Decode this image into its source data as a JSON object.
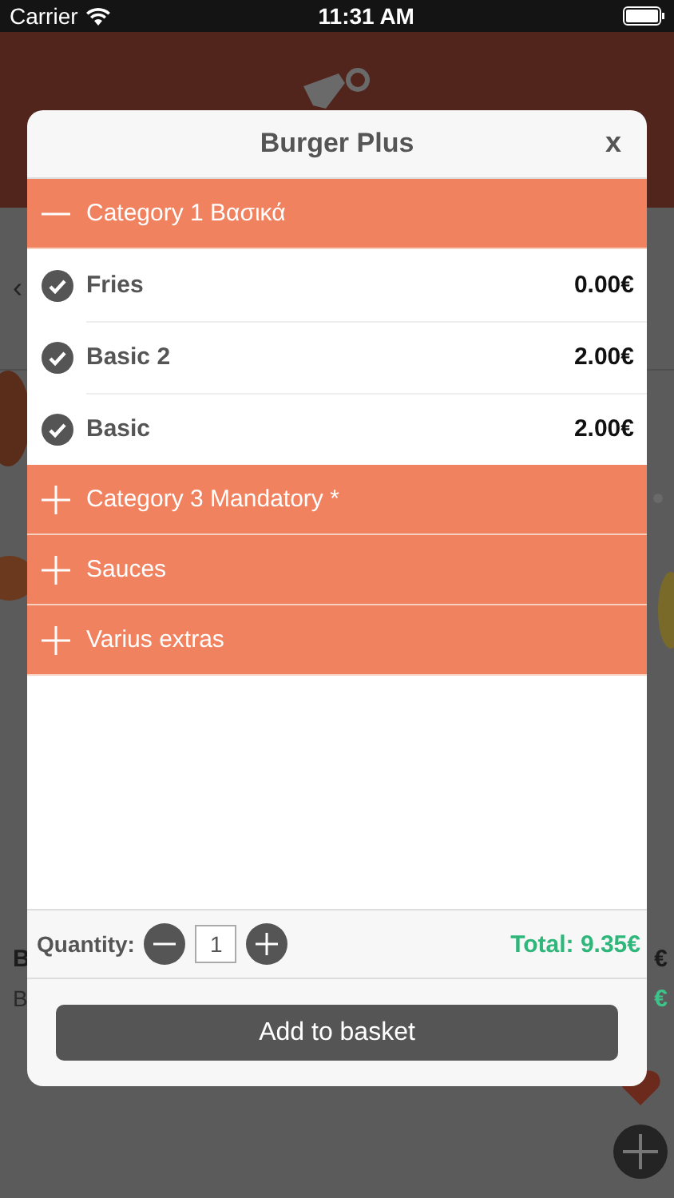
{
  "status_bar": {
    "carrier": "Carrier",
    "time": "11:31 AM"
  },
  "background": {
    "back": "‹",
    "item_name": "B",
    "item_desc": "B",
    "item_price": "€",
    "item_price_2": "€"
  },
  "modal": {
    "title": "Burger Plus",
    "close": "x",
    "categories": [
      {
        "name": "Category 1 Βασικά",
        "expanded": true,
        "options": [
          {
            "name": "Fries",
            "price": "0.00€",
            "checked": true
          },
          {
            "name": "Basic 2",
            "price": "2.00€",
            "checked": true
          },
          {
            "name": "Basic",
            "price": "2.00€",
            "checked": true
          }
        ]
      },
      {
        "name": "Category 3 Mandatory *",
        "expanded": false
      },
      {
        "name": "Sauces",
        "expanded": false
      },
      {
        "name": "Varius extras",
        "expanded": false
      }
    ],
    "quantity_label": "Quantity:",
    "quantity": "1",
    "total": "Total: 9.35€",
    "add_button": "Add to basket"
  }
}
